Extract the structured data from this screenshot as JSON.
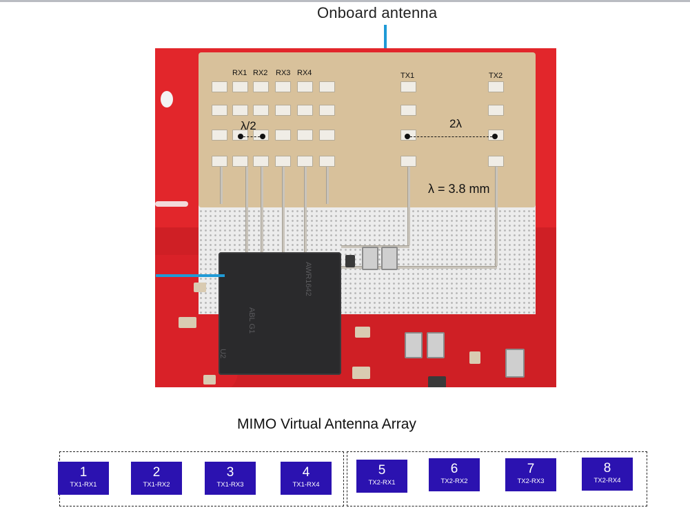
{
  "diagram": {
    "title": "Onboard antenna",
    "rx_labels": [
      "RX1",
      "RX2",
      "RX3",
      "RX4"
    ],
    "tx_labels": [
      "TX1",
      "TX2"
    ],
    "rx_spacing_label": "λ/2",
    "tx_spacing_label": "2λ",
    "wavelength_label": "λ = 3.8 mm",
    "chip_text": [
      "AWR1642",
      "ABL G1",
      "U2"
    ]
  },
  "virtual_array": {
    "title": "MIMO  Virtual Antenna Array",
    "elements": [
      {
        "number": "1",
        "pair": "TX1-RX1"
      },
      {
        "number": "2",
        "pair": "TX1-RX2"
      },
      {
        "number": "3",
        "pair": "TX1-RX3"
      },
      {
        "number": "4",
        "pair": "TX1-RX4"
      },
      {
        "number": "5",
        "pair": "TX2-RX1"
      },
      {
        "number": "6",
        "pair": "TX2-RX2"
      },
      {
        "number": "7",
        "pair": "TX2-RX3"
      },
      {
        "number": "8",
        "pair": "TX2-RX4"
      }
    ]
  },
  "colors": {
    "board": "#e2262b",
    "antenna_substrate": "#d8c19b",
    "pointer": "#1f9ad6",
    "virtual_element": "#2b12b0"
  }
}
